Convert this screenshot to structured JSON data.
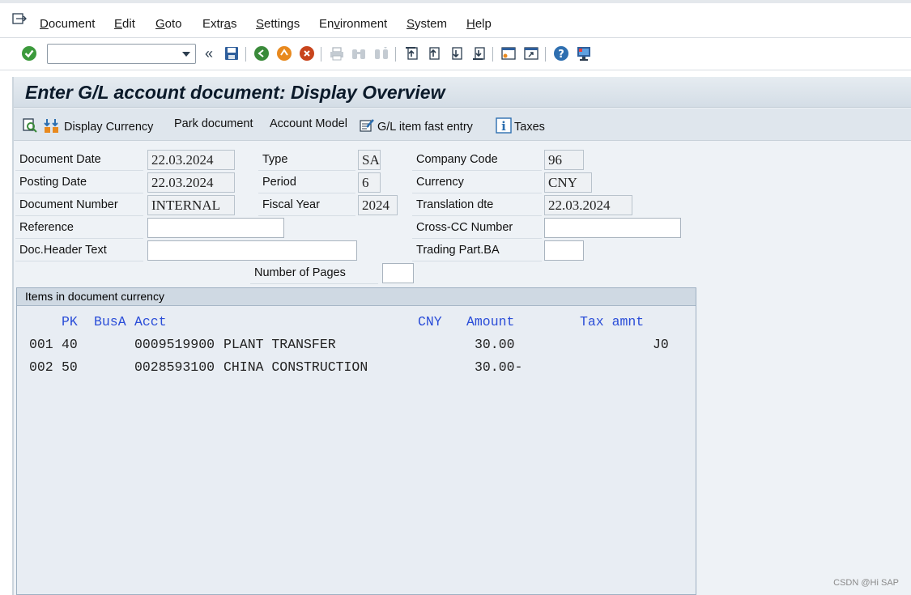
{
  "menu": {
    "items": [
      {
        "pre": "",
        "u": "D",
        "post": "ocument"
      },
      {
        "pre": "",
        "u": "E",
        "post": "dit"
      },
      {
        "pre": "",
        "u": "G",
        "post": "oto"
      },
      {
        "pre": "Extr",
        "u": "a",
        "post": "s"
      },
      {
        "pre": "",
        "u": "S",
        "post": "ettings"
      },
      {
        "pre": "En",
        "u": "v",
        "post": "ironment"
      },
      {
        "pre": "",
        "u": "S",
        "post": "ystem"
      },
      {
        "pre": "",
        "u": "H",
        "post": "elp"
      }
    ]
  },
  "toolbar": {
    "command_value": "",
    "back_arrows": "«"
  },
  "title": "Enter G/L account document: Display Overview",
  "app_toolbar": {
    "display_currency": "Display Currency",
    "park_document": "Park document",
    "account_model": "Account Model",
    "gl_fast_entry": "G/L item fast entry",
    "taxes": "Taxes"
  },
  "header": {
    "document_date_label": "Document Date",
    "document_date": "22.03.2024",
    "posting_date_label": "Posting Date",
    "posting_date": "22.03.2024",
    "document_number_label": "Document Number",
    "document_number": "INTERNAL",
    "reference_label": "Reference",
    "reference": "",
    "doc_header_text_label": "Doc.Header Text",
    "doc_header_text": "",
    "type_label": "Type",
    "type": "SA",
    "period_label": "Period",
    "period": "6",
    "fiscal_year_label": "Fiscal Year",
    "fiscal_year": "2024",
    "company_code_label": "Company Code",
    "company_code": "96",
    "currency_label": "Currency",
    "currency": "CNY",
    "translation_date_label": "Translation dte",
    "translation_date": "22.03.2024",
    "cross_cc_label": "Cross-CC Number",
    "cross_cc": "",
    "trading_part_label": "Trading Part.BA",
    "trading_part": "",
    "number_of_pages_label": "Number of Pages",
    "number_of_pages": ""
  },
  "items": {
    "panel_title": "Items in document currency",
    "columns": {
      "pk": "PK",
      "busa": "BusA",
      "acct": "Acct",
      "currency": "CNY",
      "amount": "Amount",
      "tax_amnt": "Tax amnt"
    },
    "rows": [
      {
        "no": "001",
        "pk": "40",
        "acct": "0009519900",
        "name": "PLANT TRANSFER",
        "amount": "30.00",
        "tax_code": "J0"
      },
      {
        "no": "002",
        "pk": "50",
        "acct": "0028593100",
        "name": "CHINA CONSTRUCTION",
        "amount": "30.00-",
        "tax_code": ""
      }
    ]
  },
  "watermark": "CSDN @Hi SAP"
}
